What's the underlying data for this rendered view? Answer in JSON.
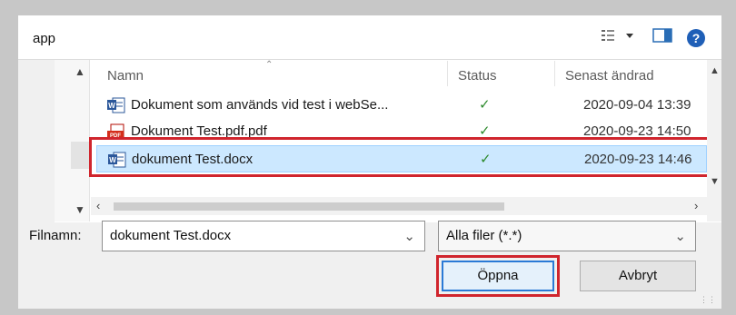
{
  "breadcrumb": "app",
  "columns": {
    "name": "Namn",
    "status": "Status",
    "modified": "Senast ändrad"
  },
  "files": [
    {
      "name": "Dokument som används vid test i webSe...",
      "status": "✓",
      "date": "2020-09-04 13:39",
      "icon": "word-icon"
    },
    {
      "name": "Dokument Test.pdf.pdf",
      "status": "✓",
      "date": "2020-09-23 14:50",
      "icon": "pdf-icon"
    },
    {
      "name": "dokument Test.docx",
      "status": "✓",
      "date": "2020-09-23 14:46",
      "icon": "word-icon"
    }
  ],
  "filename": {
    "label": "Filnamn:",
    "value": "dokument Test.docx"
  },
  "filter": {
    "value": "Alla filer (*.*)"
  },
  "buttons": {
    "open": "Öppna",
    "cancel": "Avbryt"
  },
  "colors": {
    "selection": "#cce8ff",
    "highlight": "#d0252d",
    "help": "#1f5fb7"
  }
}
